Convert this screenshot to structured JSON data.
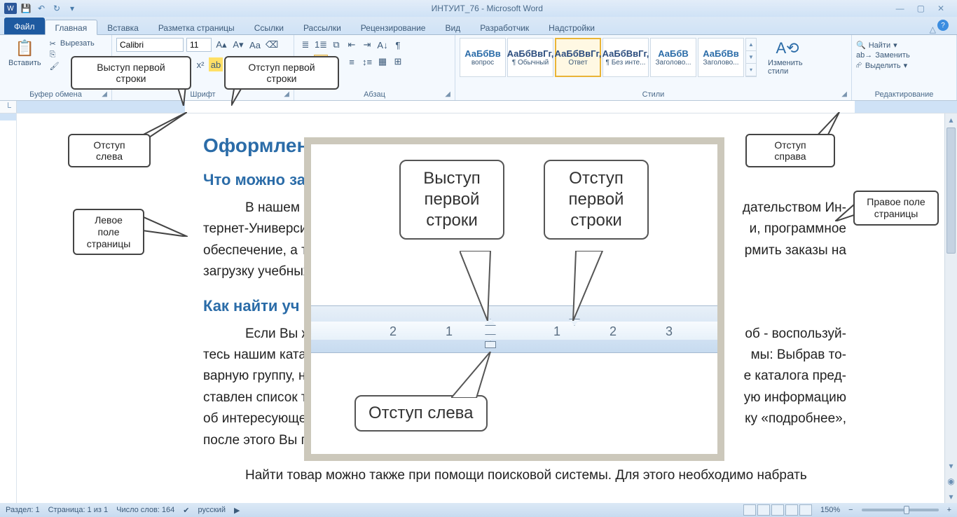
{
  "titlebar": {
    "title": "ИНТУИТ_76 - Microsoft Word"
  },
  "tabs": {
    "file": "Файл",
    "list": [
      "Главная",
      "Вставка",
      "Разметка страницы",
      "Ссылки",
      "Рассылки",
      "Рецензирование",
      "Вид",
      "Разработчик",
      "Надстройки"
    ],
    "active": 0
  },
  "ribbon": {
    "clipboard": {
      "label": "Буфер обмена",
      "paste": "Вставить",
      "cut": "Вырезать"
    },
    "font": {
      "label": "Шрифт",
      "name": "Calibri",
      "size": "11"
    },
    "paragraph": {
      "label": "Абзац"
    },
    "styles": {
      "label": "Стили",
      "tiles": [
        {
          "sample": "АаБбВв",
          "name": "вопрос",
          "blue": true
        },
        {
          "sample": "АаБбВвГг,",
          "name": "¶ Обычный"
        },
        {
          "sample": "АаБбВвГг,",
          "name": "Ответ",
          "sel": true
        },
        {
          "sample": "АаБбВвГг,",
          "name": "¶ Без инте..."
        },
        {
          "sample": "АаБбВ",
          "name": "Заголово...",
          "blue": true
        },
        {
          "sample": "АаБбВв",
          "name": "Заголово...",
          "blue": true
        }
      ],
      "change": "Изменить стили"
    },
    "editing": {
      "label": "Редактирование",
      "find": "Найти",
      "replace": "Заменить",
      "select": "Выделить"
    }
  },
  "callouts": {
    "c1": "Выступ первой строки",
    "c2": "Отступ первой строки",
    "c3": "Отступ слева",
    "c4": "Отступ справа",
    "c5": "Левое поле страницы",
    "c6": "Правое поле страницы",
    "big1": "Выступ первой строки",
    "big2": "Отступ первой строки",
    "big3": "Отступ слева"
  },
  "doc": {
    "h1": "Оформление",
    "h2a": "Что можно за",
    "p1": "В нашем и",
    "p1b": "тернет-Университ",
    "p1c": "обеспечение, а та",
    "p1d": "загрузку учебных",
    "p1r": "дательством Ин-",
    "p1r2": "и, программное",
    "p1r3": "рмить заказы на",
    "h2b": "Как найти уч",
    "p2": "Если Вы ж",
    "p2b": "тесь нашим катал",
    "p2c": "варную группу, на",
    "p2d": "ставлен список то",
    "p2e": "об интересующем",
    "p2f": "после этого Вы по",
    "p2r": "об - воспользуй-",
    "p2r2": "мы: Выбрав то-",
    "p2r3": "е каталога пред-",
    "p2r4": "ую информацию",
    "p2r5": "ку «подробнее»,",
    "p3": "Найти товар можно также при помощи поисковой системы. Для этого необходимо набрать"
  },
  "statusbar": {
    "section": "Раздел: 1",
    "page": "Страница: 1 из 1",
    "words": "Число слов: 164",
    "lang": "русский",
    "zoom": "150%"
  },
  "zoom_ruler_labels": [
    "2",
    "1",
    "1",
    "2",
    "3"
  ]
}
